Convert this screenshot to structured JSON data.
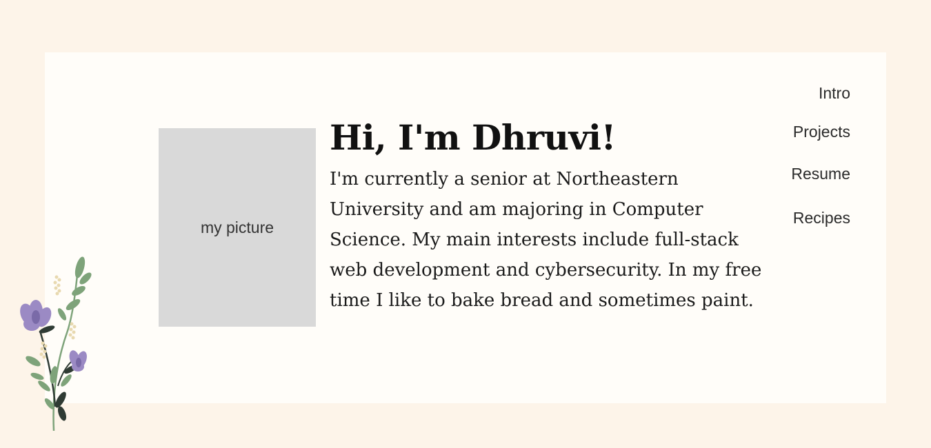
{
  "nav": {
    "items": [
      "Intro",
      "Projects",
      "Resume",
      "Recipes"
    ]
  },
  "picture": {
    "label": "my picture"
  },
  "intro": {
    "heading": "Hi, I'm Dhruvi!",
    "bio": "I'm currently a senior at Northeastern University and am majoring in Computer Science. My main interests include full-stack web development and cybersecurity. In my free time I like to bake bread and sometimes paint."
  },
  "colors": {
    "page_background": "#fdf4e9",
    "card_background": "#fffdf9",
    "picture_placeholder": "#d9d9d9",
    "flower_petal": "#9b8ac4",
    "leaf": "#7ea37a"
  },
  "icons": {
    "decoration": "lavender-flower-icon"
  }
}
